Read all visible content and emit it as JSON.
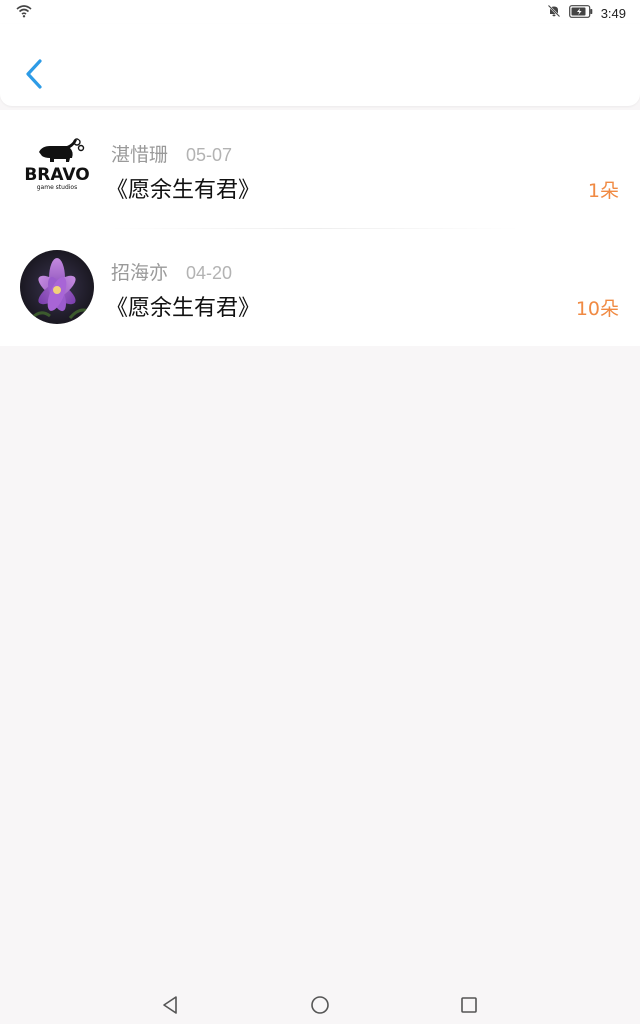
{
  "status_bar": {
    "time": "3:49",
    "icons": [
      "wifi-icon",
      "notifications-off-icon",
      "battery-icon"
    ]
  },
  "header": {
    "back_icon": "chevron-left-icon",
    "accent": "#2d9be6"
  },
  "items": [
    {
      "name": "湛惜珊",
      "date": "05-07",
      "title": "《愿余生有君》",
      "count": "1朵",
      "avatar": "BRAVO game studios"
    },
    {
      "name": "招海亦",
      "date": "04-20",
      "title": "《愿余生有君》",
      "count": "10朵",
      "avatar": "purple-flower-photo"
    }
  ],
  "nav": {
    "icons": [
      "back-triangle-icon",
      "home-circle-icon",
      "recents-square-icon"
    ]
  },
  "colors": {
    "count": "#f08a43",
    "name": "#9a9a9a",
    "background": "#f8f6f7"
  }
}
